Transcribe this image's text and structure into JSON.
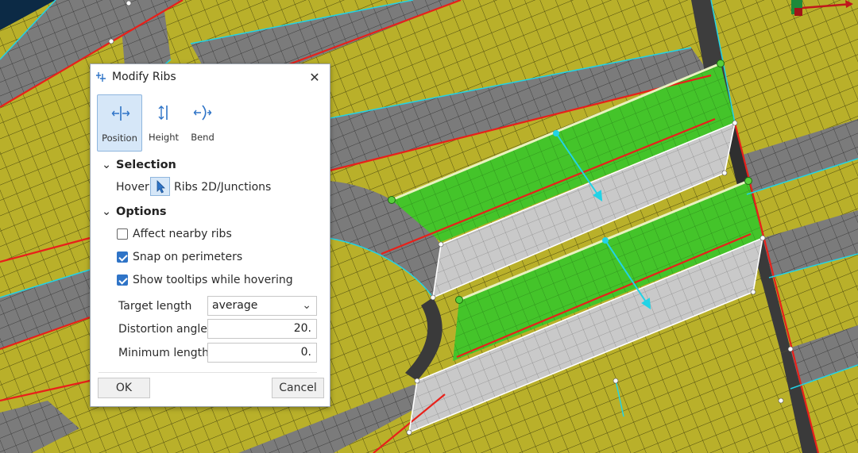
{
  "dialog": {
    "title": "Modify Ribs",
    "close_label": "✕",
    "tabs": [
      {
        "label": "Position",
        "icon": "position-icon",
        "active": true
      },
      {
        "label": "Height",
        "icon": "height-icon",
        "active": false
      },
      {
        "label": "Bend",
        "icon": "bend-icon",
        "active": false
      }
    ],
    "selection": {
      "header": "Selection",
      "hover_label": "Hover",
      "hover_icon": "cursor-arrow-icon",
      "target_label": "Ribs 2D/Junctions"
    },
    "options": {
      "header": "Options",
      "checkboxes": [
        {
          "label": "Affect nearby ribs",
          "checked": false
        },
        {
          "label": "Snap on perimeters",
          "checked": true
        },
        {
          "label": "Show tooltips while hovering",
          "checked": true
        }
      ],
      "target_length": {
        "label": "Target length",
        "value": "average"
      },
      "distortion_angle": {
        "label": "Distortion angle",
        "value": "20."
      },
      "minimum_length": {
        "label": "Minimum length",
        "value": "0."
      }
    },
    "ok_label": "OK",
    "cancel_label": "Cancel"
  },
  "colors": {
    "mesh_yellow": "#b9b02a",
    "mesh_gray": "#7b7b7b",
    "rib_white": "#c9c9c9",
    "selection_green": "#44c42a",
    "perimeter_red": "#e8201a",
    "edge_cyan": "#22d3e6",
    "accent_blue": "#2f74c7"
  }
}
